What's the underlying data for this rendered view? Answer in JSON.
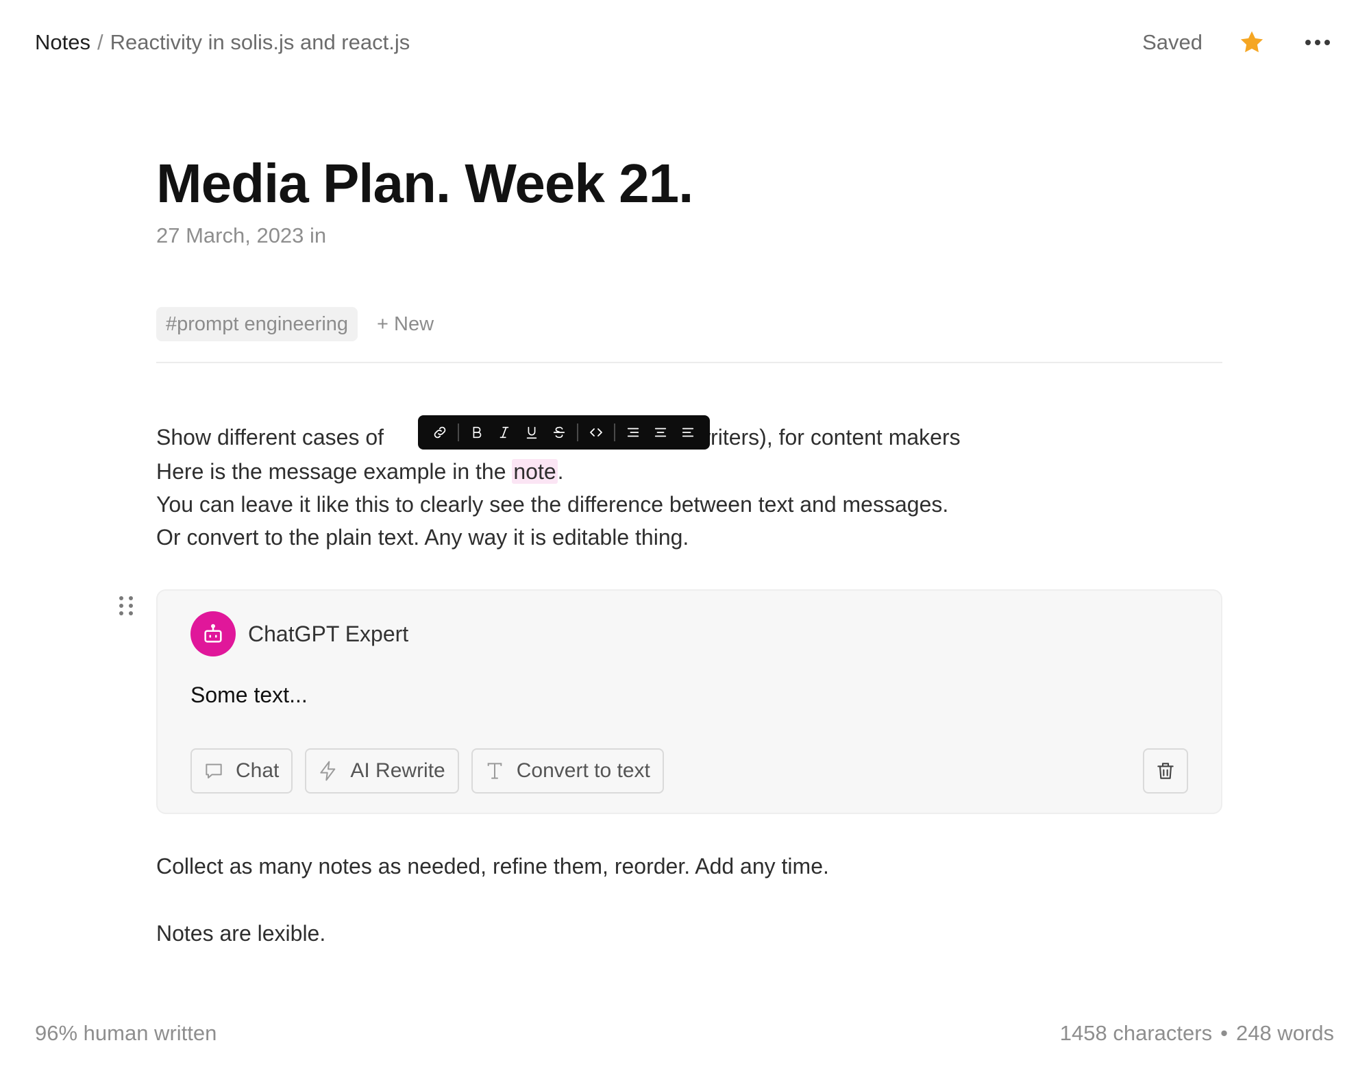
{
  "breadcrumb": {
    "root": "Notes",
    "separator": "/",
    "current": "Reactivity in solis.js and react.js"
  },
  "header": {
    "status": "Saved",
    "star_color": "#F5A623",
    "star_icon": "star-icon",
    "more_icon": "more-icon"
  },
  "note": {
    "title": "Media Plan. Week 21.",
    "date": "27 March, 2023 in",
    "tags": [
      "#prompt engineering"
    ],
    "new_tag_label": "+ New",
    "paragraphs": {
      "line1_start": "Show different cases of ",
      "line1_end": "writers), for content makers",
      "line2_start": "Here is the message example in the ",
      "line2_highlight": "note",
      "line2_end": ".",
      "line3": "You can leave it like this to clearly see the difference between text and messages.",
      "line4": "Or convert to the plain text. Any way it is editable thing.",
      "after_card_1": "Collect as many notes as needed, refine them, reorder. Add any time.",
      "after_card_2": "Notes are lexible."
    }
  },
  "format_toolbar": {
    "buttons": [
      "link-icon",
      "bold-icon",
      "italic-icon",
      "underline-icon",
      "strikethrough-icon",
      "code-icon",
      "align-left-icon",
      "align-center-icon",
      "align-right-icon"
    ]
  },
  "message_card": {
    "author": "ChatGPT Expert",
    "avatar_color": "#E0179A",
    "text": "Some text...",
    "actions": {
      "chat": "Chat",
      "rewrite": "AI Rewrite",
      "convert": "Convert to text"
    }
  },
  "footer": {
    "human_written": "96% human written",
    "characters": "1458 characters",
    "bullet": "•",
    "words": "248 words"
  }
}
